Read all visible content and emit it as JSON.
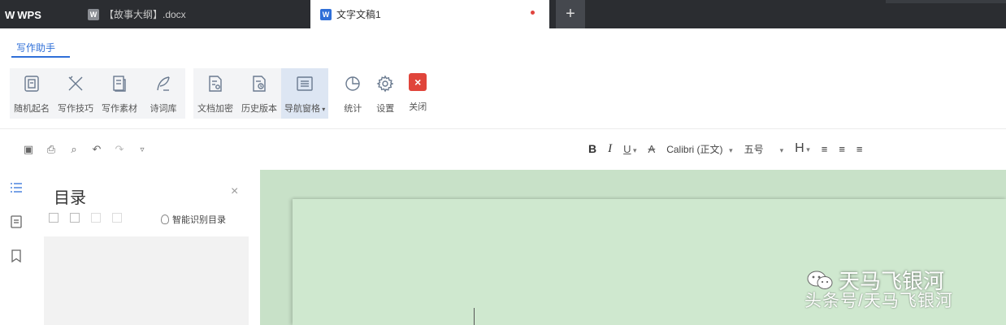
{
  "titlebar": {
    "app_name": "WPS",
    "tabs": [
      {
        "label": "【故事大纲】.docx",
        "active": false
      },
      {
        "label": "文字文稿1",
        "active": true
      }
    ],
    "new_tab_label": "+"
  },
  "assistant": {
    "tab_label": "写作助手",
    "groups": [
      [
        {
          "label": "随机起名",
          "icon": "name-card-icon"
        },
        {
          "label": "写作技巧",
          "icon": "pen-ruler-icon"
        },
        {
          "label": "写作素材",
          "icon": "material-icon"
        },
        {
          "label": "诗词库",
          "icon": "quill-icon"
        }
      ],
      [
        {
          "label": "文档加密",
          "icon": "lock-document-icon"
        },
        {
          "label": "历史版本",
          "icon": "history-document-icon"
        },
        {
          "label": "导航窗格",
          "icon": "nav-pane-icon",
          "selected": true
        }
      ],
      [
        {
          "label": "统计",
          "icon": "pie-chart-icon"
        },
        {
          "label": "设置",
          "icon": "gear-icon"
        },
        {
          "label": "关闭",
          "icon": "close-icon"
        }
      ]
    ]
  },
  "format_toolbar": {
    "bold": "B",
    "italic": "I",
    "underline": "U",
    "strike": "A",
    "font": "Calibri (正文)",
    "size": "五号",
    "heading": "H"
  },
  "toc": {
    "title": "目录",
    "close": "×",
    "smart_label": "智能识别目录"
  },
  "watermark": {
    "main": "天马飞银河",
    "sub": "头条号/天马飞银河"
  }
}
